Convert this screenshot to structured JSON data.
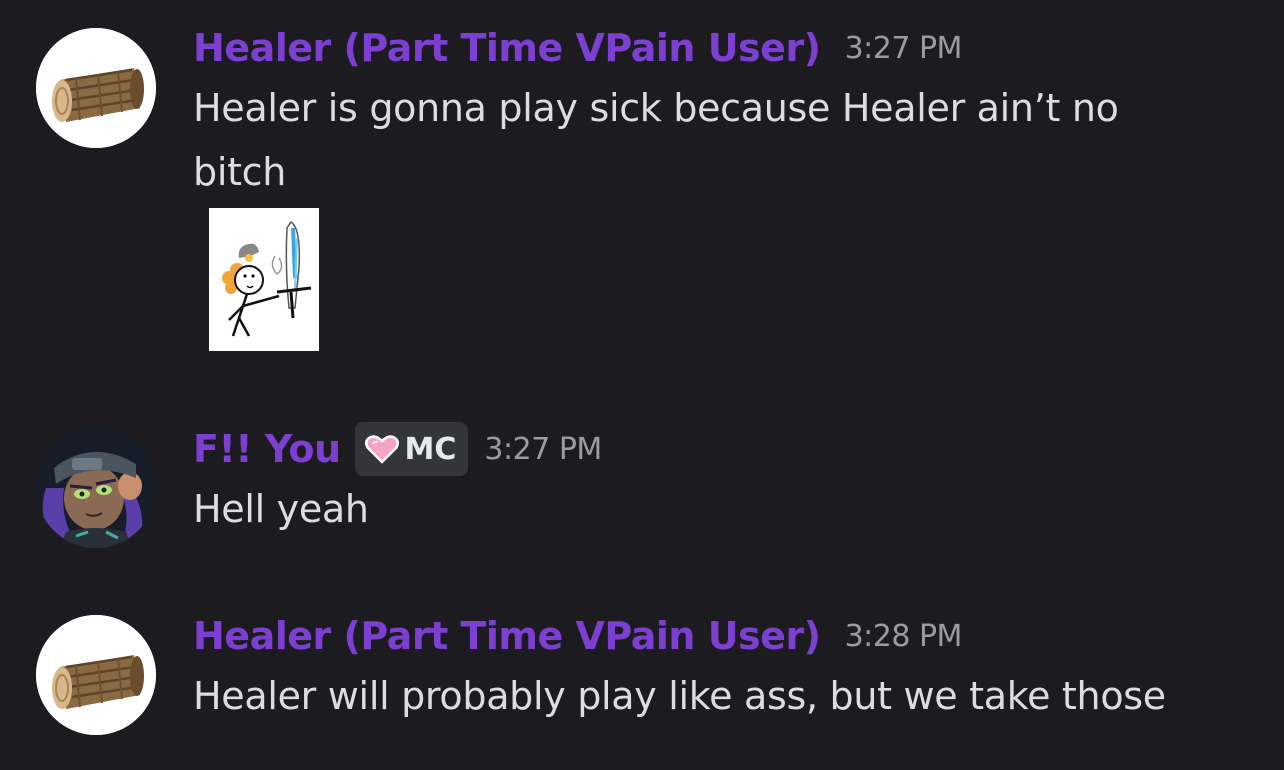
{
  "messages": [
    {
      "username": "Healer (Part Time VPain User)",
      "timestamp": "3:27 PM",
      "text": "Healer is gonna play sick because Healer ain’t no bitch",
      "avatar_icon": "log-icon",
      "attachment": "stick-figure-drawing"
    },
    {
      "username": "F!! You",
      "tag": {
        "icon": "pink-heart-icon",
        "label": "MC"
      },
      "timestamp": "3:27 PM",
      "text": "Hell yeah",
      "avatar_icon": "squid-character-avatar"
    },
    {
      "username": "Healer (Part Time VPain User)",
      "timestamp": "3:28 PM",
      "text": "Healer will probably play like ass, but we take those",
      "avatar_icon": "log-icon"
    }
  ],
  "colors": {
    "background": "#1b1b20",
    "username": "#7d3fd2",
    "timestamp": "#9a9ba3",
    "text": "#dcdde1",
    "tag_background": "#34353c",
    "heart": "#f5a3c7"
  }
}
